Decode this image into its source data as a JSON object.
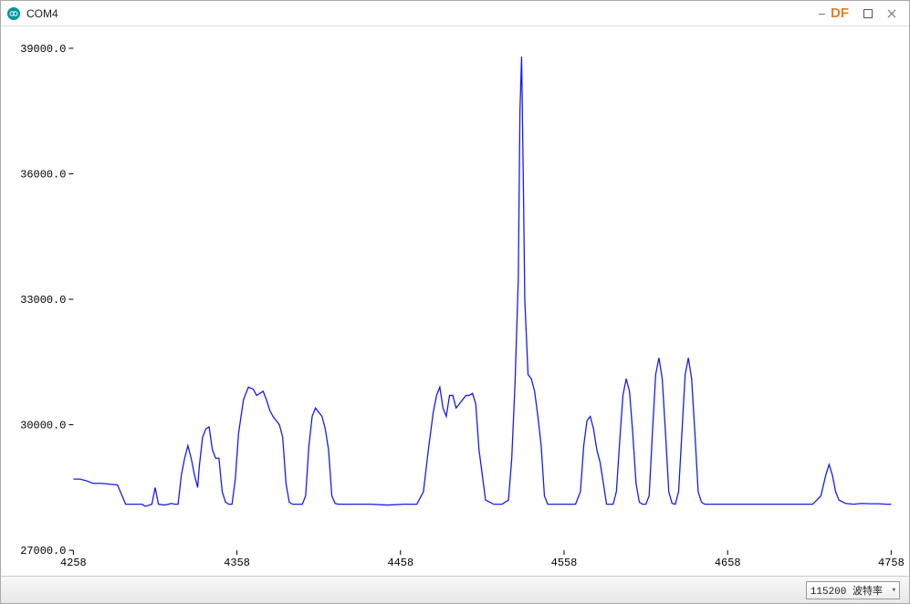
{
  "window": {
    "title": "COM4",
    "badge": "DF"
  },
  "statusbar": {
    "baud_label": "115200 波特率"
  },
  "chart_data": {
    "type": "line",
    "title": "",
    "xlabel": "",
    "ylabel": "",
    "xlim": [
      4258,
      4758
    ],
    "ylim": [
      27000,
      39000
    ],
    "x_ticks": [
      4258,
      4358,
      4458,
      4558,
      4658,
      4758
    ],
    "y_ticks": [
      27000,
      30000,
      33000,
      36000,
      39000
    ],
    "x_tick_labels": [
      "4258",
      "4358",
      "4458",
      "4558",
      "4658",
      "4758"
    ],
    "y_tick_labels": [
      "27000.0",
      "30000.0",
      "33000.0",
      "36000.0",
      "39000.0"
    ],
    "line_color": "#1a1af0",
    "series": [
      {
        "name": "value",
        "x": [
          4258,
          4262,
          4266,
          4270,
          4275,
          4280,
          4285,
          4290,
          4295,
          4300,
          4302,
          4306,
          4308,
          4310,
          4314,
          4318,
          4320,
          4322,
          4324,
          4326,
          4328,
          4330,
          4332,
          4334,
          4335,
          4337,
          4339,
          4341,
          4343,
          4345,
          4347,
          4349,
          4351,
          4353,
          4355,
          4357,
          4359,
          4362,
          4365,
          4368,
          4370,
          4372,
          4374,
          4376,
          4378,
          4380,
          4382,
          4384,
          4386,
          4388,
          4390,
          4392,
          4394,
          4396,
          4398,
          4400,
          4402,
          4404,
          4406,
          4408,
          4410,
          4412,
          4414,
          4416,
          4418,
          4420,
          4430,
          4440,
          4450,
          4460,
          4468,
          4472,
          4475,
          4478,
          4480,
          4482,
          4484,
          4486,
          4488,
          4490,
          4492,
          4494,
          4496,
          4498,
          4500,
          4502,
          4504,
          4506,
          4510,
          4515,
          4520,
          4524,
          4526,
          4528,
          4530,
          4531,
          4532,
          4533,
          4534,
          4536,
          4538,
          4540,
          4542,
          4544,
          4546,
          4548,
          4550,
          4555,
          4560,
          4565,
          4568,
          4570,
          4572,
          4574,
          4576,
          4578,
          4580,
          4582,
          4584,
          4586,
          4588,
          4590,
          4592,
          4594,
          4596,
          4598,
          4600,
          4602,
          4604,
          4606,
          4608,
          4610,
          4612,
          4614,
          4616,
          4618,
          4620,
          4622,
          4624,
          4626,
          4628,
          4630,
          4632,
          4634,
          4636,
          4638,
          4640,
          4642,
          4644,
          4646,
          4650,
          4660,
          4670,
          4680,
          4690,
          4700,
          4710,
          4715,
          4718,
          4720,
          4722,
          4724,
          4726,
          4730,
          4735,
          4740,
          4745,
          4750,
          4755,
          4758
        ],
        "values": [
          28700,
          28700,
          28660,
          28600,
          28600,
          28580,
          28560,
          28100,
          28100,
          28100,
          28050,
          28100,
          28500,
          28100,
          28080,
          28120,
          28100,
          28100,
          28800,
          29200,
          29500,
          29200,
          28800,
          28500,
          29000,
          29700,
          29900,
          29950,
          29400,
          29200,
          29200,
          28400,
          28150,
          28100,
          28100,
          28700,
          29800,
          30600,
          30900,
          30850,
          30700,
          30750,
          30800,
          30600,
          30350,
          30200,
          30100,
          30000,
          29700,
          28600,
          28150,
          28100,
          28100,
          28100,
          28100,
          28300,
          29500,
          30200,
          30400,
          30300,
          30200,
          29900,
          29400,
          28300,
          28120,
          28100,
          28100,
          28100,
          28080,
          28100,
          28100,
          28400,
          29400,
          30300,
          30700,
          30900,
          30400,
          30200,
          30700,
          30700,
          30400,
          30500,
          30600,
          30700,
          30700,
          30750,
          30500,
          29400,
          28200,
          28100,
          28100,
          28200,
          29200,
          31000,
          33500,
          37500,
          38800,
          36000,
          33000,
          31200,
          31100,
          30800,
          30200,
          29500,
          28300,
          28100,
          28100,
          28100,
          28100,
          28100,
          28400,
          29500,
          30100,
          30200,
          29900,
          29400,
          29100,
          28600,
          28100,
          28100,
          28100,
          28400,
          29600,
          30700,
          31100,
          30800,
          29800,
          28600,
          28150,
          28100,
          28100,
          28300,
          29800,
          31200,
          31600,
          31100,
          29800,
          28400,
          28120,
          28100,
          28400,
          29800,
          31200,
          31600,
          31100,
          29800,
          28400,
          28150,
          28100,
          28100,
          28100,
          28100,
          28100,
          28100,
          28100,
          28100,
          28100,
          28300,
          28800,
          29050,
          28800,
          28400,
          28200,
          28120,
          28100,
          28120,
          28110,
          28110,
          28100,
          28100
        ]
      }
    ]
  }
}
